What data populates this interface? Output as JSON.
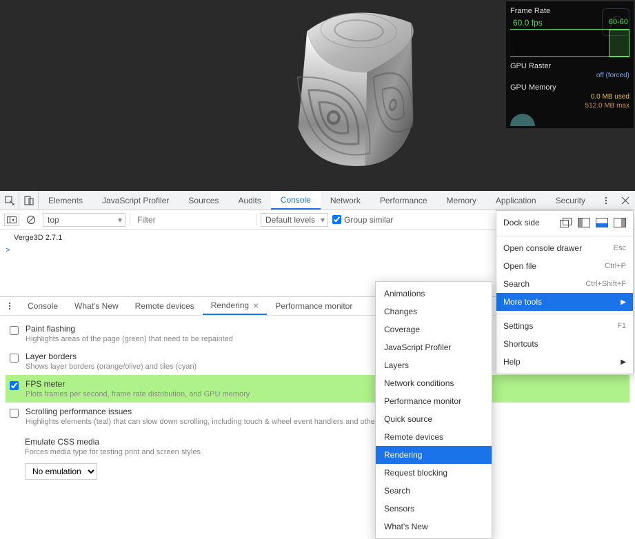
{
  "hud": {
    "frame_rate_title": "Frame Rate",
    "fps_value": "60.0 fps",
    "fps_range": "60-60",
    "gpu_raster_title": "GPU Raster",
    "gpu_raster_status": "off (forced)",
    "gpu_memory_title": "GPU Memory",
    "gpu_memory_used": "0.0 MB used",
    "gpu_memory_max": "512.0 MB max"
  },
  "devtools_tabs": {
    "elements": "Elements",
    "js_profiler": "JavaScript Profiler",
    "sources": "Sources",
    "audits": "Audits",
    "console": "Console",
    "network": "Network",
    "performance": "Performance",
    "memory": "Memory",
    "application": "Application",
    "security": "Security"
  },
  "console_toolbar": {
    "context": "top",
    "filter_placeholder": "Filter",
    "levels": "Default levels",
    "group_similar": "Group similar"
  },
  "console_body": {
    "line1": "Verge3D 2.7.1",
    "prompt": ">"
  },
  "drawer_tabs": {
    "console": "Console",
    "whats_new": "What's New",
    "remote_devices": "Remote devices",
    "rendering": "Rendering",
    "performance_monitor": "Performance monitor"
  },
  "rendering_options": {
    "paint_flashing": {
      "title": "Paint flashing",
      "desc": "Highlights areas of the page (green) that need to be repainted"
    },
    "layer_borders": {
      "title": "Layer borders",
      "desc": "Shows layer borders (orange/olive) and tiles (cyan)"
    },
    "fps_meter": {
      "title": "FPS meter",
      "desc": "Plots frames per second, frame rate distribution, and GPU memory"
    },
    "scrolling": {
      "title": "Scrolling performance issues",
      "desc": "Highlights elements (teal) that can slow down scrolling, including touch & wheel event handlers and other main-thread scrolling situations."
    },
    "emulate_css": {
      "title": "Emulate CSS media",
      "desc": "Forces media type for testing print and screen styles",
      "value": "No emulation"
    }
  },
  "main_menu": {
    "dock_side": "Dock side",
    "open_console_drawer": "Open console drawer",
    "open_console_drawer_sc": "Esc",
    "open_file": "Open file",
    "open_file_sc": "Ctrl+P",
    "search": "Search",
    "search_sc": "Ctrl+Shift+F",
    "more_tools": "More tools",
    "settings": "Settings",
    "settings_sc": "F1",
    "shortcuts": "Shortcuts",
    "help": "Help"
  },
  "submenu_items": [
    "Animations",
    "Changes",
    "Coverage",
    "JavaScript Profiler",
    "Layers",
    "Network conditions",
    "Performance monitor",
    "Quick source",
    "Remote devices",
    "Rendering",
    "Request blocking",
    "Search",
    "Sensors",
    "What's New"
  ],
  "submenu_highlight": "Rendering"
}
